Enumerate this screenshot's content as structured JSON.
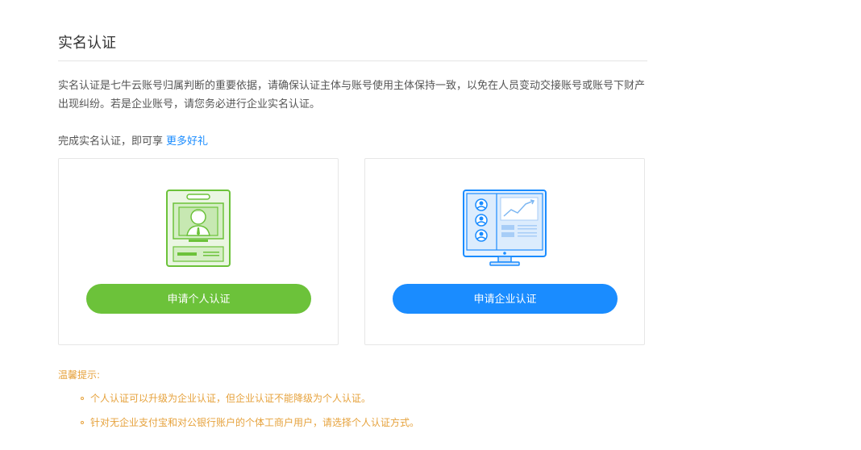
{
  "header": {
    "title": "实名认证"
  },
  "intro": {
    "text": "实名认证是七牛云账号归属判断的重要依据，请确保认证主体与账号使用主体保持一致，以免在人员变动交接账号或账号下财产出现纠纷。若是企业账号，请您务必进行企业实名认证。"
  },
  "benefit": {
    "text": "完成实名认证，即可享",
    "link_label": "更多好礼"
  },
  "cards": {
    "personal": {
      "button_label": "申请个人认证",
      "icon": "id-card-icon",
      "color": "#6cc23a"
    },
    "enterprise": {
      "button_label": "申请企业认证",
      "icon": "monitor-icon",
      "color": "#1a8cff"
    }
  },
  "tips": {
    "title": "温馨提示:",
    "items": [
      "个人认证可以升级为企业认证，但企业认证不能降级为个人认证。",
      "针对无企业支付宝和对公银行账户的个体工商户用户，请选择个人认证方式。"
    ],
    "color": "#e6a23c"
  }
}
